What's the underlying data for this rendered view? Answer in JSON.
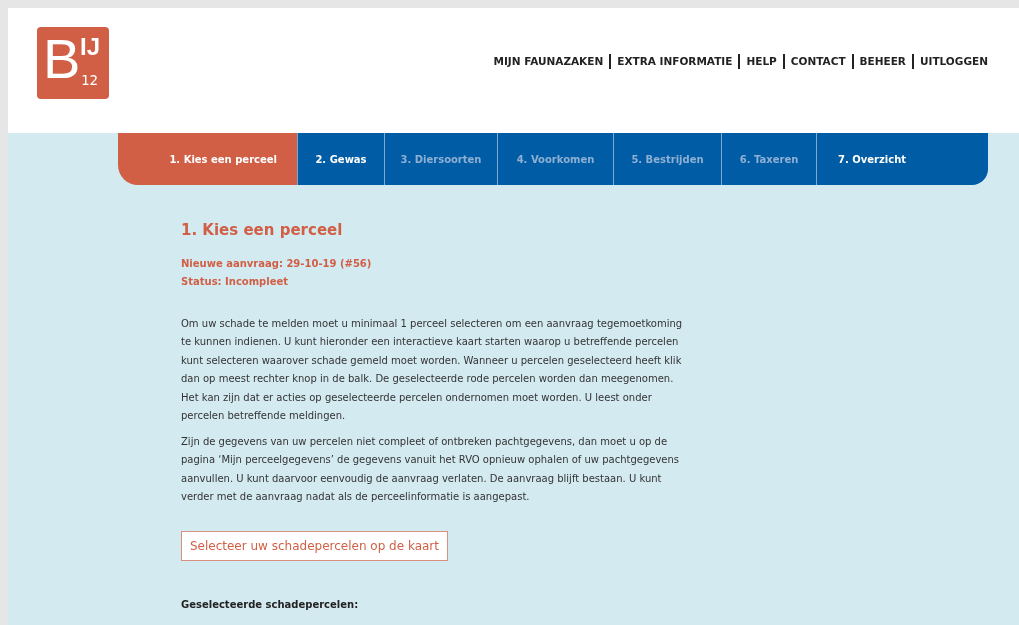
{
  "logo": {
    "letter": "B",
    "superscript": "IJ",
    "subscript": "12"
  },
  "nav": [
    "MIJN FAUNAZAKEN",
    "EXTRA INFORMATIE",
    "HELP",
    "CONTACT",
    "BEHEER",
    "UITLOGGEN"
  ],
  "steps": [
    {
      "label": "1. Kies een perceel",
      "selected": true,
      "disabled": false
    },
    {
      "label": "2. Gewas",
      "selected": false,
      "disabled": false
    },
    {
      "label": "3. Diersoorten",
      "selected": false,
      "disabled": true
    },
    {
      "label": "4. Voorkomen",
      "selected": false,
      "disabled": true
    },
    {
      "label": "5. Bestrijden",
      "selected": false,
      "disabled": true
    },
    {
      "label": "6. Taxeren",
      "selected": false,
      "disabled": true
    },
    {
      "label": "7. Overzicht",
      "selected": false,
      "disabled": false
    }
  ],
  "heading": "1. Kies een perceel",
  "meta": [
    "Nieuwe aanvraag: 29-10-19 (#56)",
    "Status: Incompleet"
  ],
  "paragraphs": [
    "Om uw schade te melden moet u minimaal 1 perceel selecteren om een aanvraag tegemoetkoming te kunnen indienen. U kunt hieronder een interactieve kaart starten waarop u betreffende percelen kunt selecteren waarover schade gemeld moet worden. Wanneer u percelen geselecteerd heeft klik dan op meest rechter knop in de balk. De geselecteerde rode percelen worden dan meegenomen. Het kan zijn dat er acties op geselecteerde percelen ondernomen moet worden. U leest onder percelen betreffende meldingen.",
    "Zijn de gegevens van uw percelen niet compleet of ontbreken pachtgegevens, dan moet u op de pagina ‘Mijn perceelgegevens’ de gegevens vanuit het RVO opnieuw ophalen of uw pachtgegevens aanvullen. U kunt daarvoor eenvoudig de aanvraag verlaten. De aanvraag blijft bestaan. U kunt verder met de aanvraag nadat als de perceelinformatie is aangepast."
  ],
  "map_button": "Selecteer uw schadepercelen op de kaart",
  "selected_heading": "Geselecteerde schadepercelen:"
}
